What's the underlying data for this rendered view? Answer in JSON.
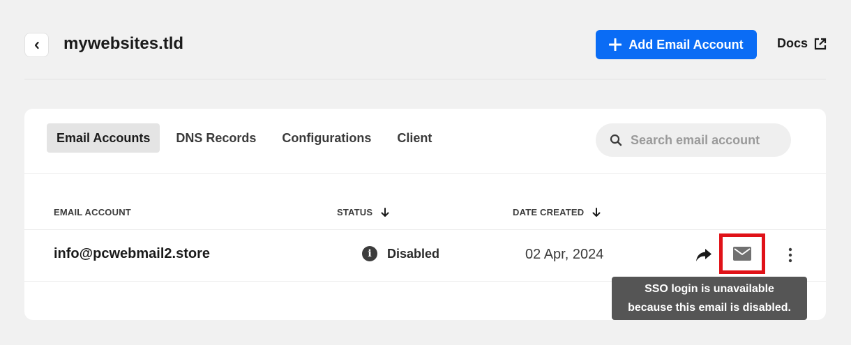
{
  "header": {
    "title": "mywebsites.tld",
    "add_button_label": "Add Email Account",
    "docs_label": "Docs"
  },
  "tabs": [
    {
      "label": "Email Accounts",
      "active": true
    },
    {
      "label": "DNS Records",
      "active": false
    },
    {
      "label": "Configurations",
      "active": false
    },
    {
      "label": "Client",
      "active": false
    }
  ],
  "search": {
    "placeholder": "Search email account",
    "value": ""
  },
  "table": {
    "columns": [
      "EMAIL ACCOUNT",
      "STATUS",
      "DATE CREATED"
    ],
    "rows": [
      {
        "email": "info@pcwebmail2.store",
        "status": "Disabled",
        "date_created": "02 Apr, 2024"
      }
    ]
  },
  "tooltip": {
    "line1": "SSO login is unavailable",
    "line2": "because this email is disabled."
  },
  "colors": {
    "accent": "#0a6cf5",
    "highlight_border": "#e01218",
    "tooltip_bg": "#555555"
  },
  "icons": [
    "chevron-left-icon",
    "plus-icon",
    "external-link-icon",
    "search-icon",
    "sort-arrow-icon",
    "info-icon",
    "share-arrow-icon",
    "mail-icon",
    "more-vertical-icon"
  ]
}
